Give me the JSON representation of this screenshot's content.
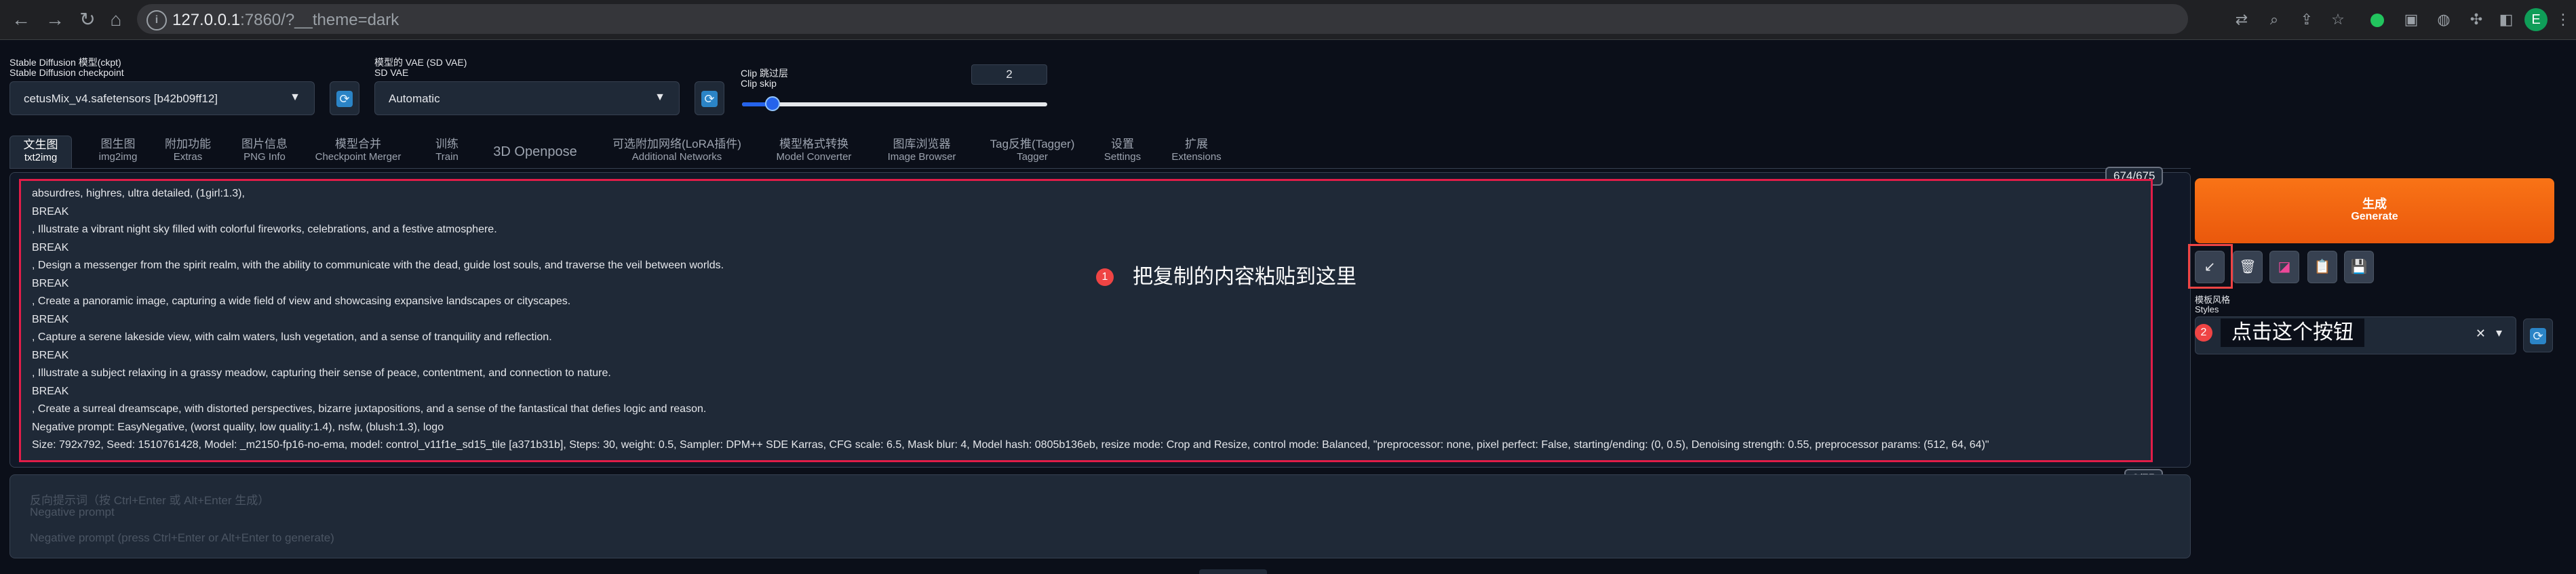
{
  "browser": {
    "url_host": "127.0.0.1",
    "url_rest": ":7860/?__theme=dark",
    "profile_initial": "E"
  },
  "model": {
    "ckpt_label_cn": "Stable Diffusion 模型(ckpt)",
    "ckpt_label_en": "Stable Diffusion checkpoint",
    "ckpt_value": "cetusMix_v4.safetensors [b42b09ff12]",
    "vae_label_cn": "模型的 VAE (SD VAE)",
    "vae_label_en": "SD VAE",
    "vae_value": "Automatic",
    "clip_label_cn": "Clip 跳过层",
    "clip_label_en": "Clip skip",
    "clip_value": "2",
    "clip_slider_fraction": 0.1
  },
  "tabs": [
    {
      "cn": "文生图",
      "en": "txt2img",
      "active": true
    },
    {
      "cn": "图生图",
      "en": "img2img"
    },
    {
      "cn": "附加功能",
      "en": "Extras"
    },
    {
      "cn": "图片信息",
      "en": "PNG Info"
    },
    {
      "cn": "模型合并",
      "en": "Checkpoint Merger"
    },
    {
      "cn": "训练",
      "en": "Train"
    },
    {
      "cn": "3D Openpose",
      "en": ""
    },
    {
      "cn": "可选附加网络(LoRA插件)",
      "en": "Additional Networks"
    },
    {
      "cn": "模型格式转换",
      "en": "Model Converter"
    },
    {
      "cn": "图库浏览器",
      "en": "Image Browser"
    },
    {
      "cn": "Tag反推(Tagger)",
      "en": "Tagger"
    },
    {
      "cn": "设置",
      "en": "Settings"
    },
    {
      "cn": "扩展",
      "en": "Extensions"
    }
  ],
  "prompt": {
    "counter": "674/675",
    "lines": [
      "absurdres, highres, ultra detailed, (1girl:1.3),",
      "BREAK",
      ", Illustrate a vibrant night sky filled with colorful fireworks, celebrations, and a festive atmosphere.",
      "BREAK",
      ", Design a messenger from the spirit realm, with the ability to communicate with the dead, guide lost souls, and traverse the veil between worlds.",
      "BREAK",
      ", Create a panoramic image, capturing a wide field of view and showcasing expansive landscapes or cityscapes.",
      "BREAK",
      ", Capture a serene lakeside view, with calm waters, lush vegetation, and a sense of tranquility and reflection.",
      "BREAK",
      ", Illustrate a subject relaxing in a grassy meadow, capturing their sense of peace, contentment, and connection to nature.",
      "BREAK",
      ", Create a surreal dreamscape, with distorted perspectives, bizarre juxtapositions, and a sense of the fantastical that defies logic and reason.",
      "Negative prompt: EasyNegative, (worst quality, low quality:1.4),  nsfw,  (blush:1.3), logo",
      "Size: 792x792, Seed: 1510761428, Model: _m2150-fp16-no-ema, model: control_v11f1e_sd15_tile [a371b31b], Steps: 30, weight: 0.5, Sampler: DPM++ SDE Karras, CFG scale: 6.5, Mask blur: 4, Model hash: 0805b136eb, resize mode: Crop and Resize, control mode: Balanced, \"preprocessor: none, pixel perfect: False, starting/ending: (0, 0.5), Denoising strength: 0.55, preprocessor params: (512, 64, 64)\""
    ],
    "callout_num": "1",
    "callout_text": "把复制的内容粘贴到这里"
  },
  "negative": {
    "counter": "0/75",
    "label_cn": "反向提示词（按 Ctrl+Enter 或 Alt+Enter 生成）",
    "label_en": "Negative prompt",
    "placeholder": "Negative prompt (press Ctrl+Enter or Alt+Enter to generate)"
  },
  "side": {
    "generate_cn": "生成",
    "generate_en": "Generate",
    "styles_label_cn": "模板风格",
    "styles_label_en": "Styles",
    "callout_num": "2",
    "callout_text": "点击这个按钮",
    "clear_glyph": "✕",
    "caret_glyph": "▾"
  },
  "colors": {
    "background": "#0b0f19",
    "accent_orange": "#f97316",
    "highlight_red": "#ef4444",
    "refresh_blue": "#2b84c6",
    "slider_blue": "#2563eb"
  }
}
